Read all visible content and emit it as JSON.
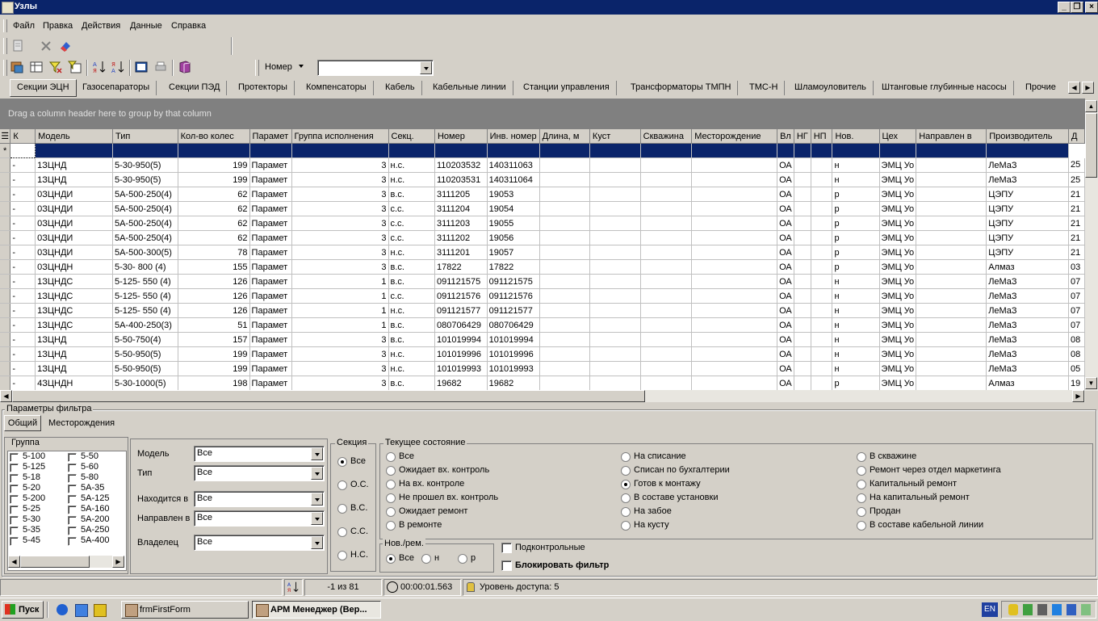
{
  "window": {
    "title": "Узлы"
  },
  "menu": [
    "Файл",
    "Правка",
    "Действия",
    "Данные",
    "Справка"
  ],
  "toolbar": {
    "search_label": "Номер",
    "search_value": ""
  },
  "tabs": [
    "Секции ЭЦН",
    "Газосепараторы",
    "Секции ПЭД",
    "Протекторы",
    "Компенсаторы",
    "Кабель",
    "Кабельные линии",
    "Станции управления",
    "Трансформаторы ТМПН",
    "ТМС-Н",
    "Шламоуловитель",
    "Штанговые глубинные насосы",
    "Прочие"
  ],
  "grid": {
    "group_hint": "Drag a column header here to group by that column",
    "columns": [
      "К",
      "Модель",
      "Тип",
      "Кол-во колес",
      "Парамет",
      "Группа исполнения",
      "Секц.",
      "Номер",
      "Инв. номер",
      "Длина, м",
      "Куст",
      "Скважина",
      "Месторождение",
      "Вл",
      "НГ",
      "НП",
      "Нов.",
      "Цех",
      "Направлен в",
      "Производитель",
      "Д"
    ],
    "rows": [
      [
        "-",
        "1ЗЦНД",
        "5-30-950(5)",
        "199",
        "Парамет",
        "3",
        "н.с.",
        "110203532",
        "140311063",
        "",
        "",
        "",
        "",
        "ОА",
        "",
        "",
        "н",
        "ЭМЦ Уо",
        "",
        "ЛеМаЗ",
        "25"
      ],
      [
        "-",
        "1ЗЦНД",
        "5-30-950(5)",
        "199",
        "Парамет",
        "3",
        "н.с.",
        "110203531",
        "140311064",
        "",
        "",
        "",
        "",
        "ОА",
        "",
        "",
        "н",
        "ЭМЦ Уо",
        "",
        "ЛеМаЗ",
        "25"
      ],
      [
        "-",
        "0ЗЦНДИ",
        "5А-500-250(4)",
        "62",
        "Парамет",
        "3",
        "в.с.",
        "3111205",
        "19053",
        "",
        "",
        "",
        "",
        "ОА",
        "",
        "",
        "р",
        "ЭМЦ Уо",
        "",
        "ЦЭПУ",
        "21"
      ],
      [
        "-",
        "0ЗЦНДИ",
        "5А-500-250(4)",
        "62",
        "Парамет",
        "3",
        "с.с.",
        "3111204",
        "19054",
        "",
        "",
        "",
        "",
        "ОА",
        "",
        "",
        "р",
        "ЭМЦ Уо",
        "",
        "ЦЭПУ",
        "21"
      ],
      [
        "-",
        "0ЗЦНДИ",
        "5А-500-250(4)",
        "62",
        "Парамет",
        "3",
        "с.с.",
        "3111203",
        "19055",
        "",
        "",
        "",
        "",
        "ОА",
        "",
        "",
        "р",
        "ЭМЦ Уо",
        "",
        "ЦЭПУ",
        "21"
      ],
      [
        "-",
        "0ЗЦНДИ",
        "5А-500-250(4)",
        "62",
        "Парамет",
        "3",
        "с.с.",
        "3111202",
        "19056",
        "",
        "",
        "",
        "",
        "ОА",
        "",
        "",
        "р",
        "ЭМЦ Уо",
        "",
        "ЦЭПУ",
        "21"
      ],
      [
        "-",
        "0ЗЦНДИ",
        "5А-500-300(5)",
        "78",
        "Парамет",
        "3",
        "н.с.",
        "3111201",
        "19057",
        "",
        "",
        "",
        "",
        "ОА",
        "",
        "",
        "р",
        "ЭМЦ Уо",
        "",
        "ЦЭПУ",
        "21"
      ],
      [
        "-",
        "0ЗЦНДН",
        "5-30- 800 (4)",
        "155",
        "Парамет",
        "3",
        "в.с.",
        "17822",
        "17822",
        "",
        "",
        "",
        "",
        "ОА",
        "",
        "",
        "р",
        "ЭМЦ Уо",
        "",
        "Алмаз",
        "03"
      ],
      [
        "-",
        "1ЗЦНДС",
        "5-125- 550 (4)",
        "126",
        "Парамет",
        "1",
        "в.с.",
        "091121575",
        "091121575",
        "",
        "",
        "",
        "",
        "ОА",
        "",
        "",
        "н",
        "ЭМЦ Уо",
        "",
        "ЛеМаЗ",
        "07"
      ],
      [
        "-",
        "1ЗЦНДС",
        "5-125- 550 (4)",
        "126",
        "Парамет",
        "1",
        "с.с.",
        "091121576",
        "091121576",
        "",
        "",
        "",
        "",
        "ОА",
        "",
        "",
        "н",
        "ЭМЦ Уо",
        "",
        "ЛеМаЗ",
        "07"
      ],
      [
        "-",
        "1ЗЦНДС",
        "5-125- 550 (4)",
        "126",
        "Парамет",
        "1",
        "н.с.",
        "091121577",
        "091121577",
        "",
        "",
        "",
        "",
        "ОА",
        "",
        "",
        "н",
        "ЭМЦ Уо",
        "",
        "ЛеМаЗ",
        "07"
      ],
      [
        "-",
        "1ЗЦНДС",
        "5А-400-250(3)",
        "51",
        "Парамет",
        "1",
        "в.с.",
        "080706429",
        "080706429",
        "",
        "",
        "",
        "",
        "ОА",
        "",
        "",
        "н",
        "ЭМЦ Уо",
        "",
        "ЛеМаЗ",
        "07"
      ],
      [
        "-",
        "1ЗЦНД",
        "5-50-750(4)",
        "157",
        "Парамет",
        "3",
        "в.с.",
        "101019994",
        "101019994",
        "",
        "",
        "",
        "",
        "ОА",
        "",
        "",
        "н",
        "ЭМЦ Уо",
        "",
        "ЛеМаЗ",
        "08"
      ],
      [
        "-",
        "1ЗЦНД",
        "5-50-950(5)",
        "199",
        "Парамет",
        "3",
        "н.с.",
        "101019996",
        "101019996",
        "",
        "",
        "",
        "",
        "ОА",
        "",
        "",
        "н",
        "ЭМЦ Уо",
        "",
        "ЛеМаЗ",
        "08"
      ],
      [
        "-",
        "1ЗЦНД",
        "5-50-950(5)",
        "199",
        "Парамет",
        "3",
        "н.с.",
        "101019993",
        "101019993",
        "",
        "",
        "",
        "",
        "ОА",
        "",
        "",
        "н",
        "ЭМЦ Уо",
        "",
        "ЛеМаЗ",
        "05"
      ],
      [
        "-",
        "4ЗЦНДН",
        "5-30-1000(5)",
        "198",
        "Парамет",
        "3",
        "в.с.",
        "19682",
        "19682",
        "",
        "",
        "",
        "",
        "ОА",
        "",
        "",
        "р",
        "ЭМЦ Уо",
        "",
        "Алмаз",
        "19"
      ]
    ]
  },
  "filter": {
    "title": "Параметры фильтра",
    "tabs": [
      "Общий",
      "Месторождения"
    ],
    "group": {
      "title": "Группа",
      "col1": [
        "5-100",
        "5-125",
        "5-18",
        "5-20",
        "5-200",
        "5-25",
        "5-30",
        "5-35",
        "5-45"
      ],
      "col2": [
        "5-50",
        "5-60",
        "5-80",
        "5А-35",
        "5А-125",
        "5А-160",
        "5А-200",
        "5А-250",
        "5А-400"
      ]
    },
    "fields": {
      "model_label": "Модель",
      "model_value": "Все",
      "type_label": "Тип",
      "type_value": "Все",
      "location_label": "Находится в",
      "location_value": "Все",
      "direction_label": "Направлен в",
      "direction_value": "Все",
      "owner_label": "Владелец",
      "owner_value": "Все"
    },
    "section": {
      "title": "Секция",
      "options": [
        "Все",
        "О.С.",
        "В.С.",
        "С.С.",
        "Н.С."
      ],
      "selected": "Все"
    },
    "state": {
      "title": "Текущее состояние",
      "col1": [
        "Все",
        "Ожидает вх. контроль",
        "На вх. контроле",
        "Не прошел вх. контроль",
        "Ожидает ремонт",
        "В ремонте"
      ],
      "col2": [
        "На списание",
        "Списан по бухгалтерии",
        "Готов к монтажу",
        "В составе установки",
        "На забое",
        "На кусту"
      ],
      "col3": [
        "В скважине",
        "Ремонт через отдел маркетинга",
        "Капитальный ремонт",
        "На капитальный ремонт",
        "Продан",
        "В составе кабельной линии"
      ],
      "selected": "Готов к монтажу"
    },
    "newrem": {
      "title": "Нов./рем.",
      "options": [
        "Все",
        "н",
        "р"
      ],
      "selected": "Все"
    },
    "controlled_label": "Подконтрольные",
    "block_label": "Блокировать фильтр"
  },
  "status": {
    "position": "-1 из 81",
    "timer": "00:00:01.563",
    "access": "Уровень доступа: 5"
  },
  "taskbar": {
    "start": "Пуск",
    "task1": "frmFirstForm",
    "task2": "АРМ Менеджер (Вер...",
    "lang": "EN"
  }
}
